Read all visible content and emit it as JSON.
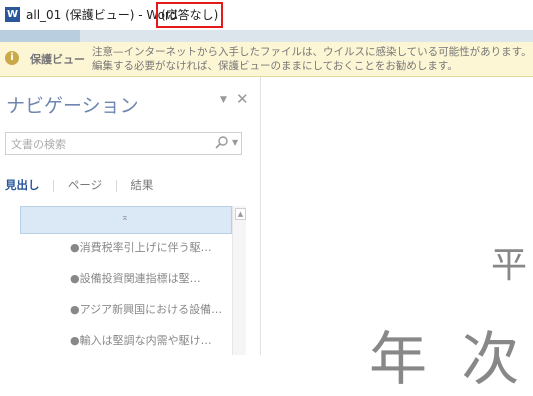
{
  "window": {
    "app_icon": "word-icon",
    "icon_letter": "W",
    "title": "all_01 (保護ビュー) - Word",
    "status": "(応答なし)",
    "highlight_color": "#e21a1a"
  },
  "message_bar": {
    "icon": "info-icon",
    "title": "保護ビュー",
    "text": "注意—インターネットから入手したファイルは、ウイルスに感染している可能性があります。編集する必要がなければ、保護ビューのままにしておくことをお勧めします。"
  },
  "navigation": {
    "title": "ナビゲーション",
    "dropdown_icon": "▼",
    "close_icon": "✕",
    "search": {
      "placeholder": "文書の検索",
      "value": ""
    },
    "tabs": [
      {
        "label": "見出し",
        "active": true
      },
      {
        "label": "ページ",
        "active": false
      },
      {
        "label": "結果",
        "active": false
      }
    ],
    "collapse_glyph": "⌅",
    "headings": [
      "●消費税率引上げに伴う駆…",
      "●設備投資関連指標は堅…",
      "●アジア新興国における設備…",
      "●輸入は堅調な内需や駆け…"
    ]
  },
  "document": {
    "line1": "平",
    "line2": "年 次"
  },
  "colors": {
    "accent": "#2b579a",
    "nav_title": "#6f87b0",
    "message_bar_bg": "#fdf6d5"
  }
}
